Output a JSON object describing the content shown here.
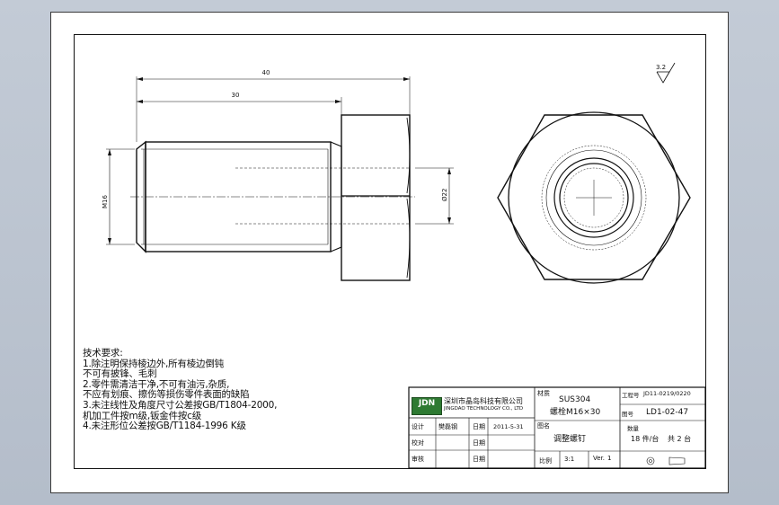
{
  "dimensions": {
    "overall_length": "40",
    "thread_length": "30",
    "thread_dia": "M16",
    "head_dia": "Ø22"
  },
  "roughness": "3.2",
  "tech_notes": {
    "title": "技术要求:",
    "lines": [
      "1.除注明保持棱边外,所有棱边倒钝",
      "  不可有披锋、毛刺",
      "2.零件需清洁干净,不可有油污,杂质,",
      "  不应有划痕、擦伤等损伤零件表面的缺陷",
      "3.未注线性及角度尺寸公差按GB/T1804-2000,",
      "  机加工件按m级,钣金件按c级",
      "4.未注形位公差按GB/T1184-1996 K级"
    ]
  },
  "title_block": {
    "logo": "JDN",
    "company_cn": "深圳市晶岛科技有限公司",
    "company_en": "JINGDAO TECHNOLOGY CO., LTD",
    "material_label": "材质",
    "material_value": "SUS304",
    "spec_value": "螺栓M16×30",
    "project_label": "工程号",
    "project_value": "JD11-0219/0220",
    "drawing_no_label": "图号",
    "drawing_no_value": "LD1-02-47",
    "quantity_label": "数量",
    "quantity_value": "18 件/台",
    "sheets_value": "共 2 台",
    "name_label": "图名",
    "name_value": "调整螺钉",
    "design_label": "设计",
    "designer": "樊磊钢",
    "date_label": "日期",
    "date_value": "2011-5-31",
    "check_label": "校对",
    "approve_label": "审核",
    "scale_label": "比例",
    "scale_value": "3:1",
    "version_label": "Ver.",
    "version_value": "1"
  }
}
